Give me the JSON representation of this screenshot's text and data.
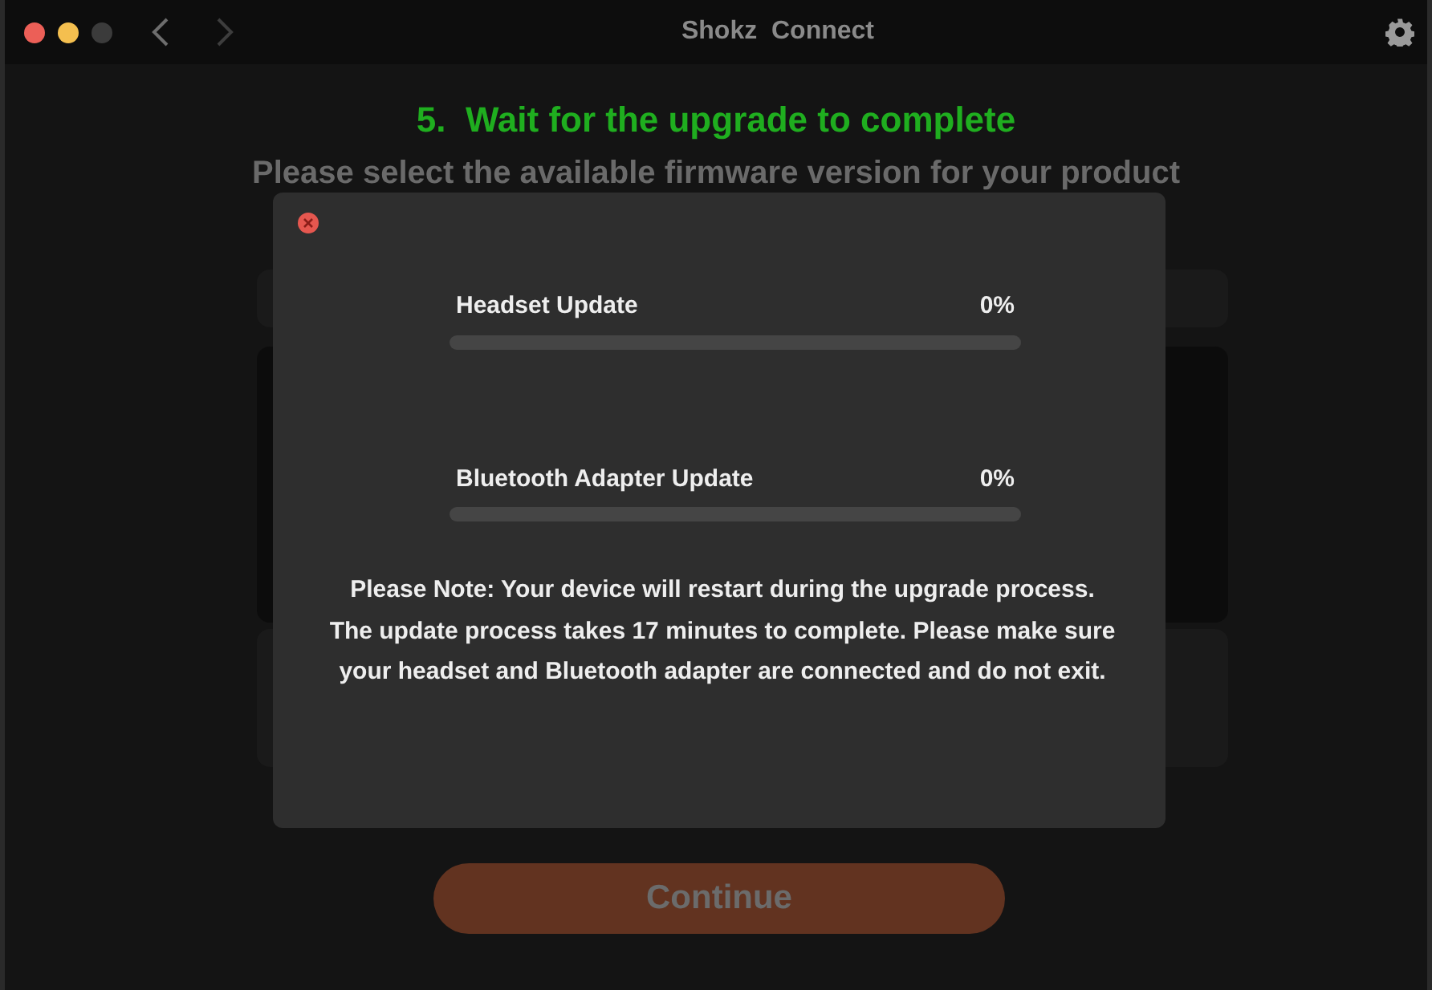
{
  "window": {
    "title": "Shokz  Connect"
  },
  "step_title": "5.  Wait for the upgrade to complete",
  "subtitle": "Please select the available firmware version for your product",
  "dialog": {
    "progress": [
      {
        "label": "Headset Update",
        "reading": "0%",
        "level": 0
      },
      {
        "label": "Bluetooth Adapter Update",
        "reading": "0%",
        "level": 0
      }
    ],
    "notes": [
      "Please Note: Your device will restart during the upgrade process.",
      "The update process takes 17 minutes to complete. Please make sure your headset and Bluetooth adapter are connected and do not exit."
    ]
  },
  "continue_button": {
    "label": "Continue",
    "disabled": true
  }
}
